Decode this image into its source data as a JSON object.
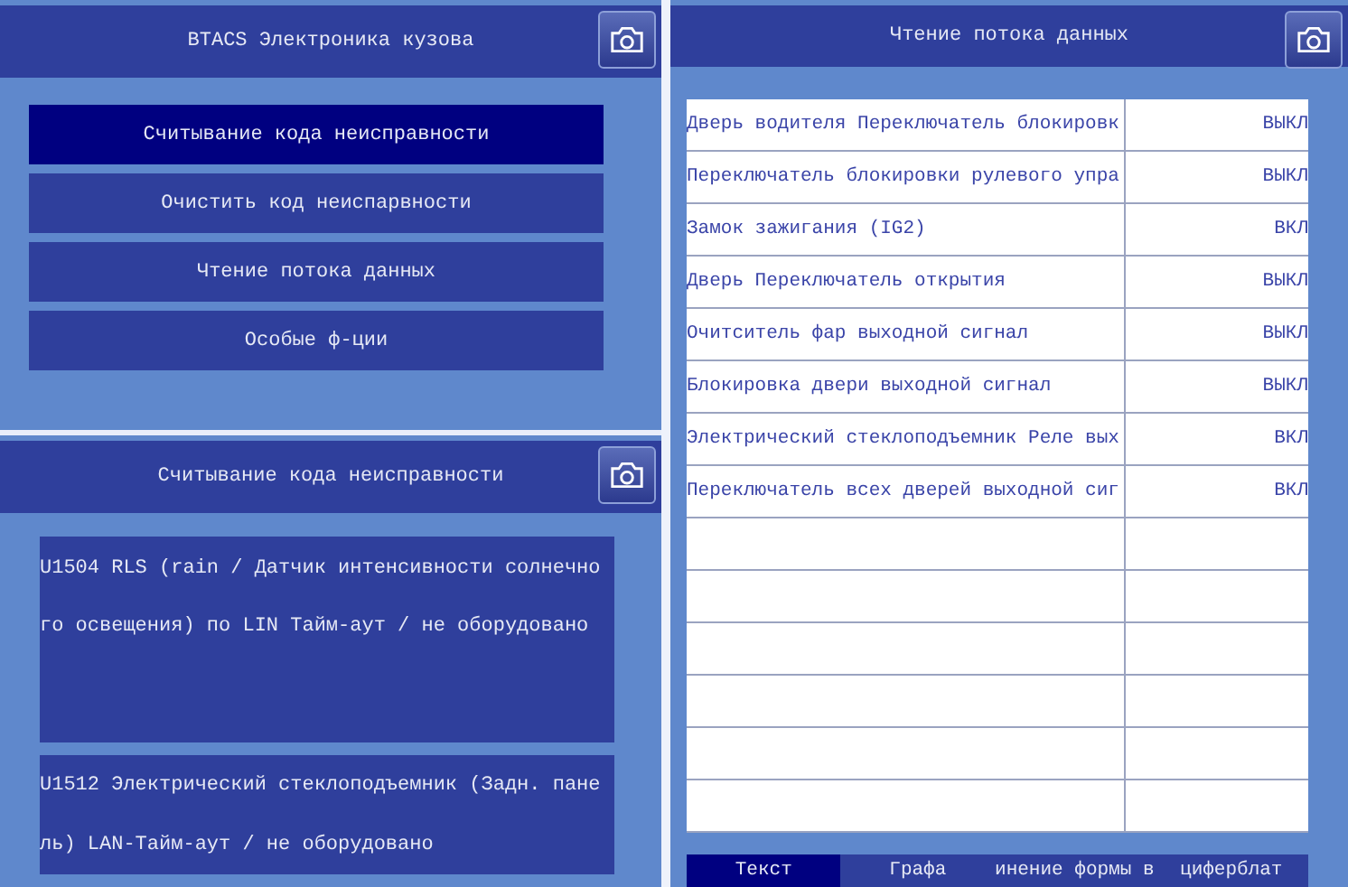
{
  "menu_panel": {
    "title": "BTACS Электроника кузова",
    "items": [
      {
        "label": "Считывание кода неисправности",
        "selected": true
      },
      {
        "label": "Очистить код неиспарвности",
        "selected": false
      },
      {
        "label": "Чтение потока данных",
        "selected": false
      },
      {
        "label": "Особые ф-ции",
        "selected": false
      }
    ]
  },
  "codes_panel": {
    "title": "Считывание кода неисправности",
    "codes": [
      {
        "lines": [
          "U1504 RLS (rain / Датчик интенсивности солнечно",
          "го освещения) по LIN Тайм-аут / не оборудовано"
        ]
      },
      {
        "lines": [
          "U1512 Электрический стеклоподъемник (Задн. пане",
          "ль) LAN-Тайм-аут / не оборудовано"
        ]
      }
    ]
  },
  "data_panel": {
    "title": "Чтение потока данных",
    "rows": [
      {
        "name": "Дверь водителя Переключатель блокировк",
        "value": "ВЫКЛ"
      },
      {
        "name": "Переключатель блокировки рулевого упра",
        "value": "ВЫКЛ"
      },
      {
        "name": "Замок зажигания (IG2)",
        "value": "ВКЛ"
      },
      {
        "name": "Дверь Переключатель открытия",
        "value": "ВЫКЛ"
      },
      {
        "name": "Очитситель фар выходной сигнал",
        "value": "ВЫКЛ"
      },
      {
        "name": "Блокировка двери выходной сигнал",
        "value": "ВЫКЛ"
      },
      {
        "name": "Электрический стеклоподъемник Реле вых",
        "value": "ВКЛ"
      },
      {
        "name": "Переключатель всех дверей выходной сиг",
        "value": "ВКЛ"
      }
    ],
    "tabs": [
      {
        "label": "Текст",
        "selected": true
      },
      {
        "label": "Графа",
        "selected": false
      },
      {
        "label": "инение формы в",
        "selected": false
      },
      {
        "label": "циферблат",
        "selected": false
      }
    ]
  }
}
